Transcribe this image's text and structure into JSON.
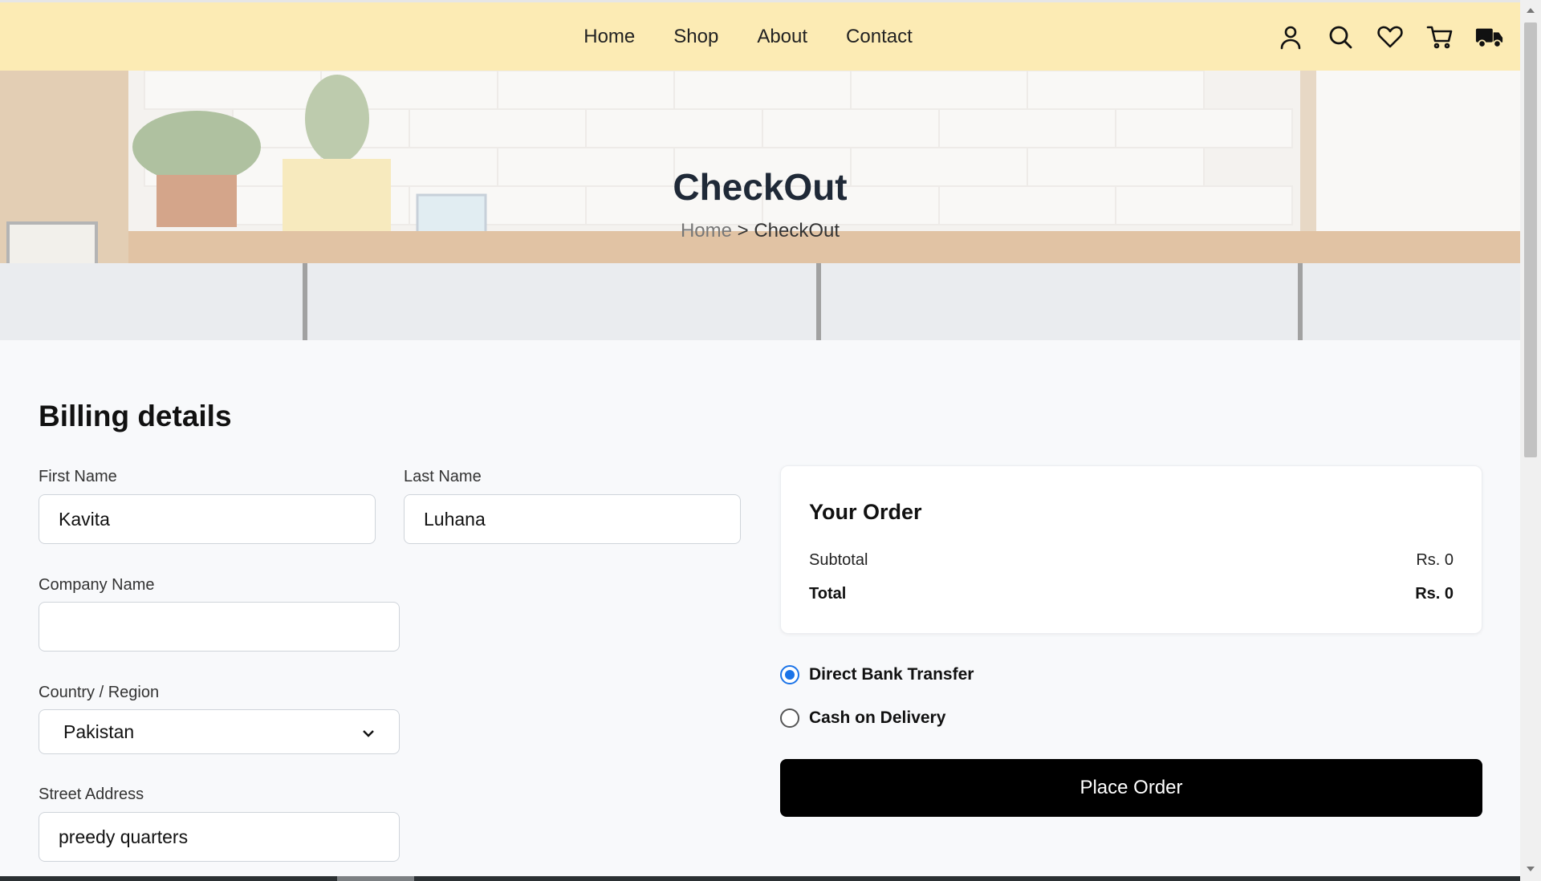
{
  "nav": {
    "items": [
      "Home",
      "Shop",
      "About",
      "Contact"
    ]
  },
  "icons": [
    "user-icon",
    "search-icon",
    "heart-icon",
    "cart-icon",
    "truck-icon"
  ],
  "hero": {
    "title": "CheckOut",
    "breadcrumb_home": "Home",
    "breadcrumb_sep": " > ",
    "breadcrumb_current": "CheckOut"
  },
  "billing": {
    "title": "Billing details",
    "first_name_label": "First Name",
    "first_name_value": "Kavita",
    "last_name_label": "Last Name",
    "last_name_value": "Luhana",
    "company_label": "Company Name",
    "company_value": "",
    "country_label": "Country / Region",
    "country_value": "Pakistan",
    "street_label": "Street Address",
    "street_value": "preedy quarters"
  },
  "order": {
    "title": "Your Order",
    "subtotal_label": "Subtotal",
    "subtotal_value": "Rs. 0",
    "total_label": "Total",
    "total_value": "Rs. 0"
  },
  "payment": {
    "options": [
      {
        "label": "Direct Bank Transfer",
        "selected": true
      },
      {
        "label": "Cash on Delivery",
        "selected": false
      }
    ],
    "place_order_label": "Place Order"
  },
  "colors": {
    "header_bg": "#fcebb4",
    "radio_accent": "#1a73e8",
    "button_bg": "#000000"
  }
}
